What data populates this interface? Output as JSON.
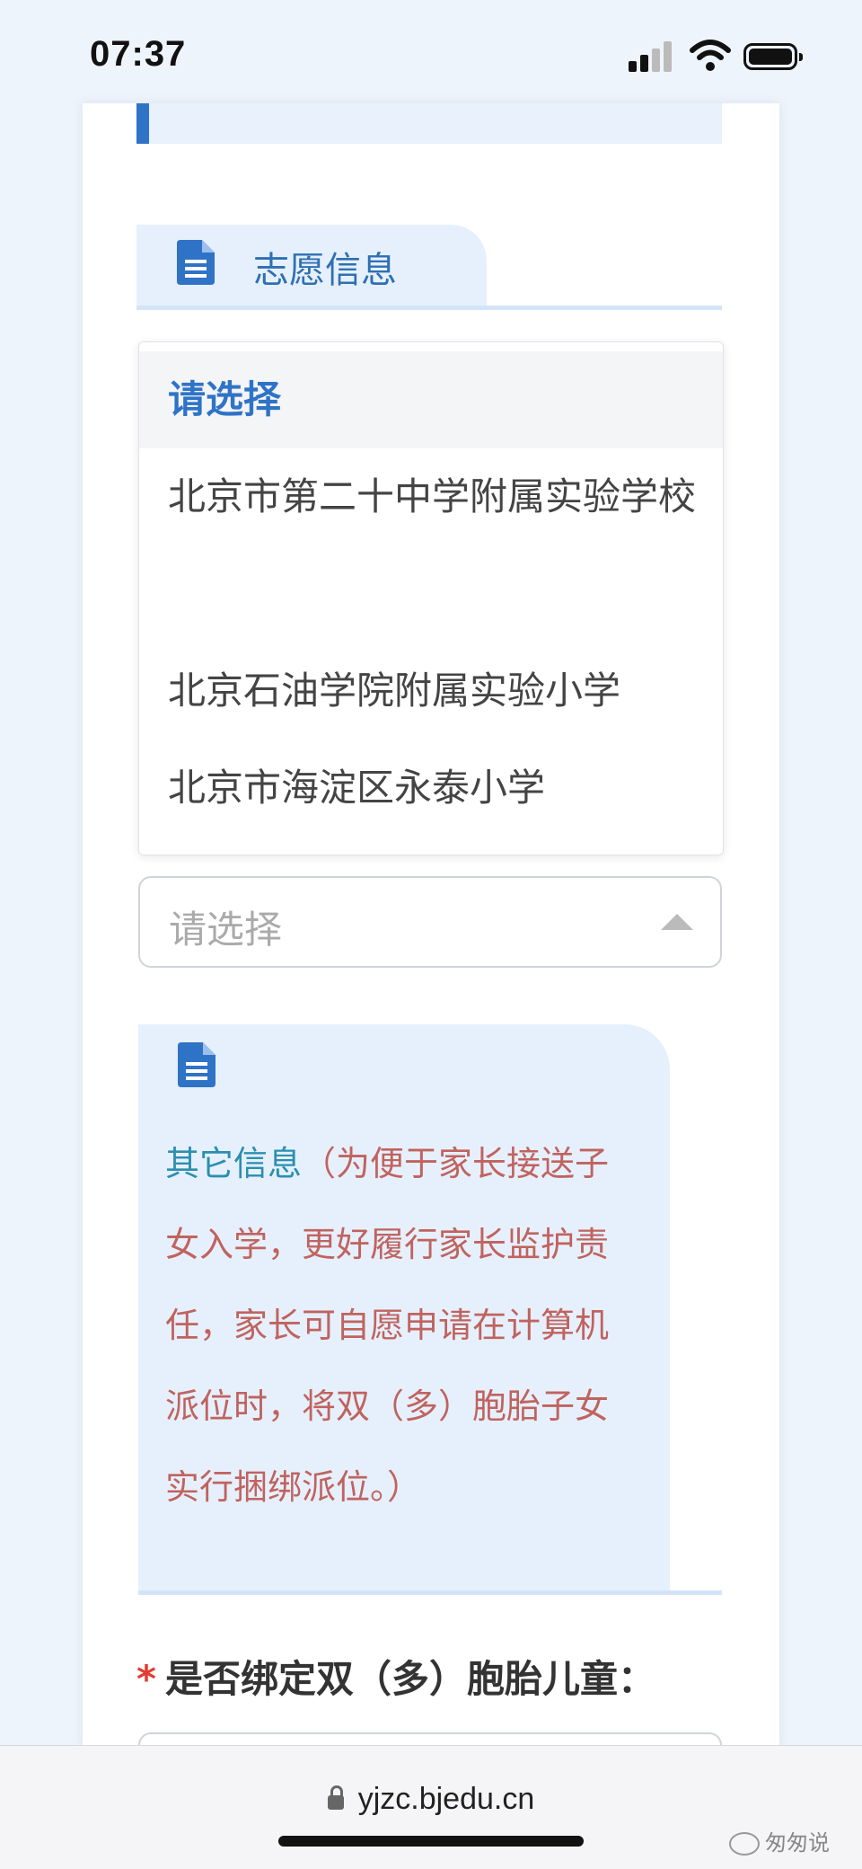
{
  "status": {
    "time": "07:37"
  },
  "section": {
    "title": "志愿信息"
  },
  "dropdown": {
    "selected_label": "请选择",
    "options": [
      "北京市第二十中学附属实验学校",
      "北京石油学院附属实验小学",
      "北京市海淀区永泰小学"
    ]
  },
  "select": {
    "placeholder": "请选择"
  },
  "other_info": {
    "lead": "其它信息",
    "text": "（为便于家长接送子女入学，更好履行家长监护责任，家长可自愿申请在计算机派位时，将双（多）胞胎子女实行捆绑派位。）"
  },
  "field": {
    "required_mark": "*",
    "label": "是否绑定双（多）胞胎儿童："
  },
  "browser": {
    "url": "yjzc.bjedu.cn"
  },
  "watermark": {
    "text": "匆匆说"
  }
}
